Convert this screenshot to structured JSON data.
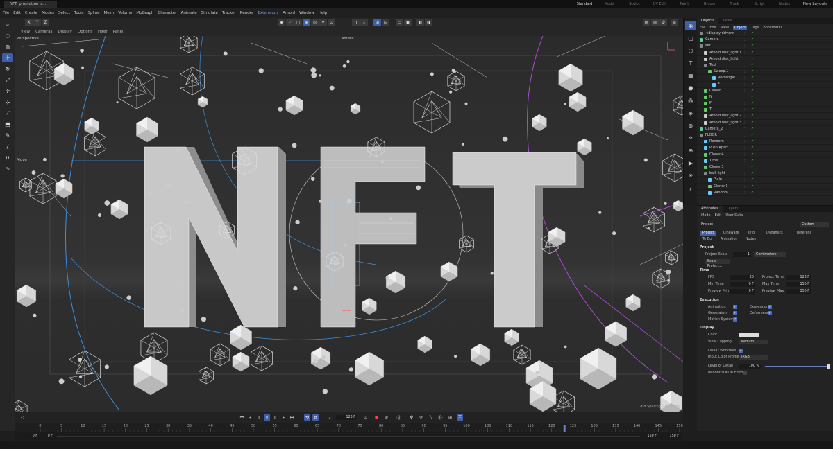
{
  "titlebar": {
    "tab": "NFT_promotion_s..."
  },
  "layouts": [
    {
      "label": "Standard",
      "active": true
    },
    {
      "label": "Model"
    },
    {
      "label": "Sculpt"
    },
    {
      "label": "UV Edit"
    },
    {
      "label": "Paint"
    },
    {
      "label": "Groom"
    },
    {
      "label": "Track"
    },
    {
      "label": "Script"
    },
    {
      "label": "Nodes"
    }
  ],
  "new_layouts": "New Layouts",
  "menu": [
    "File",
    "Edit",
    "Create",
    "Modes",
    "Select",
    "Tools",
    "Spline",
    "Mesh",
    "Volume",
    "MoGraph",
    "Character",
    "Animate",
    "Simulate",
    "Tracker",
    "Render",
    "Extensions",
    "Arnold",
    "Window",
    "Help"
  ],
  "coords": [
    "X",
    "Y",
    "Z"
  ],
  "viewport": {
    "menu": [
      "View",
      "Cameras",
      "Display",
      "Options",
      "Filter",
      "Panel"
    ],
    "label": "Perspective",
    "camera": "Camera",
    "move": "Move",
    "grid": "Grid Spacing : 1000 cm"
  },
  "objects": {
    "tabs": [
      "Objects",
      "Takes"
    ],
    "menu": [
      "File",
      "Edit",
      "View",
      "Object",
      "Tags",
      "Bookmarks"
    ],
    "rows": [
      {
        "name": "<display driver>",
        "indent": 0,
        "color": "#888"
      },
      {
        "name": "Camera",
        "indent": 0,
        "color": "#6c9"
      },
      {
        "name": "set",
        "indent": 0,
        "color": "#888"
      },
      {
        "name": "Arnold disk_light.1",
        "indent": 1,
        "color": "#ccc"
      },
      {
        "name": "Arnold disk_light",
        "indent": 1,
        "color": "#ccc"
      },
      {
        "name": "Text",
        "indent": 1,
        "color": "#888"
      },
      {
        "name": "Sweep.1",
        "indent": 2,
        "color": "#6c6"
      },
      {
        "name": "Rectangle",
        "indent": 3,
        "color": "#6cf"
      },
      {
        "name": "F",
        "indent": 3,
        "color": "#6cf"
      },
      {
        "name": "Cloner",
        "indent": 1,
        "color": "#6c6"
      },
      {
        "name": "N",
        "indent": 1,
        "color": "#6c6"
      },
      {
        "name": "F",
        "indent": 1,
        "color": "#6c6"
      },
      {
        "name": "T",
        "indent": 1,
        "color": "#6c6"
      },
      {
        "name": "Arnold disk_light.2",
        "indent": 1,
        "color": "#ccc"
      },
      {
        "name": "Arnold disk_light.3",
        "indent": 1,
        "color": "#ccc"
      },
      {
        "name": "Camera_2",
        "indent": 0,
        "color": "#6c9"
      },
      {
        "name": "FLOOR",
        "indent": 0,
        "color": "#888"
      },
      {
        "name": "Random",
        "indent": 1,
        "color": "#6cf"
      },
      {
        "name": "Push Apart",
        "indent": 1,
        "color": "#6cf"
      },
      {
        "name": "Cloner.4",
        "indent": 1,
        "color": "#6c6"
      },
      {
        "name": "Time",
        "indent": 1,
        "color": "#6cf"
      },
      {
        "name": "Cloner.3",
        "indent": 1,
        "color": "#6c6"
      },
      {
        "name": "ball_light",
        "indent": 1,
        "color": "#888"
      },
      {
        "name": "Plain",
        "indent": 2,
        "color": "#6cf"
      },
      {
        "name": "Cloner.1",
        "indent": 2,
        "color": "#6c6"
      },
      {
        "name": "Random",
        "indent": 2,
        "color": "#6cf"
      }
    ]
  },
  "attributes": {
    "tabs": [
      "Attributes",
      "Layers"
    ],
    "menu": [
      "Mode",
      "Edit",
      "User Data"
    ],
    "object": "Project",
    "preset": "Custom",
    "ptabs_row1": [
      "Project",
      "Cineware",
      "Info",
      "Dynamics",
      "Referenc"
    ],
    "ptabs_row2": [
      "To Do",
      "Animation",
      "Nodes"
    ],
    "section_project": "Project",
    "project_scale_label": "Project Scale",
    "project_scale_value": "1",
    "project_scale_unit": "Centimeters",
    "scale_button": "Scale Project...",
    "section_time": "Time",
    "fps_label": "FPS",
    "fps": "25",
    "project_time_label": "Project Time",
    "project_time": "123 F",
    "min_time_label": "Min Time",
    "min_time": "0 F",
    "max_time_label": "Max Time",
    "max_time": "150 F",
    "preview_min_label": "Preview Min",
    "preview_min": "0 F",
    "preview_max_label": "Preview Max",
    "preview_max": "150 F",
    "section_execution": "Execution",
    "animation": "Animation",
    "expression": "Expression",
    "generators": "Generators",
    "deformers": "Deformers",
    "motion_system": "Motion System",
    "section_display": "Display",
    "color_label": "Color",
    "view_clipping_label": "View Clipping",
    "view_clipping": "Medium",
    "linear_workflow": "Linear Workflow",
    "input_color_label": "Input Color Profile",
    "input_color": "sRGB",
    "lod_label": "Level of Detail",
    "lod": "100 %",
    "render_lod": "Render LOD in Editor"
  },
  "timeline": {
    "current_frame": "123 F",
    "ticks": [
      "0",
      "5",
      "10",
      "15",
      "20",
      "25",
      "30",
      "35",
      "40",
      "45",
      "50",
      "55",
      "60",
      "65",
      "70",
      "75",
      "80",
      "85",
      "90",
      "95",
      "100",
      "105",
      "110",
      "115",
      "120",
      "125",
      "130",
      "135",
      "140",
      "145",
      "150"
    ],
    "playhead": 123,
    "start": "0 F",
    "start2": "0 F",
    "end": "150 F",
    "end2": "150 F"
  },
  "colors": {
    "accent": "#3f5ea8",
    "viewport_bg": "#2b2b2b",
    "highlight_menu": "#7aa2ff"
  }
}
